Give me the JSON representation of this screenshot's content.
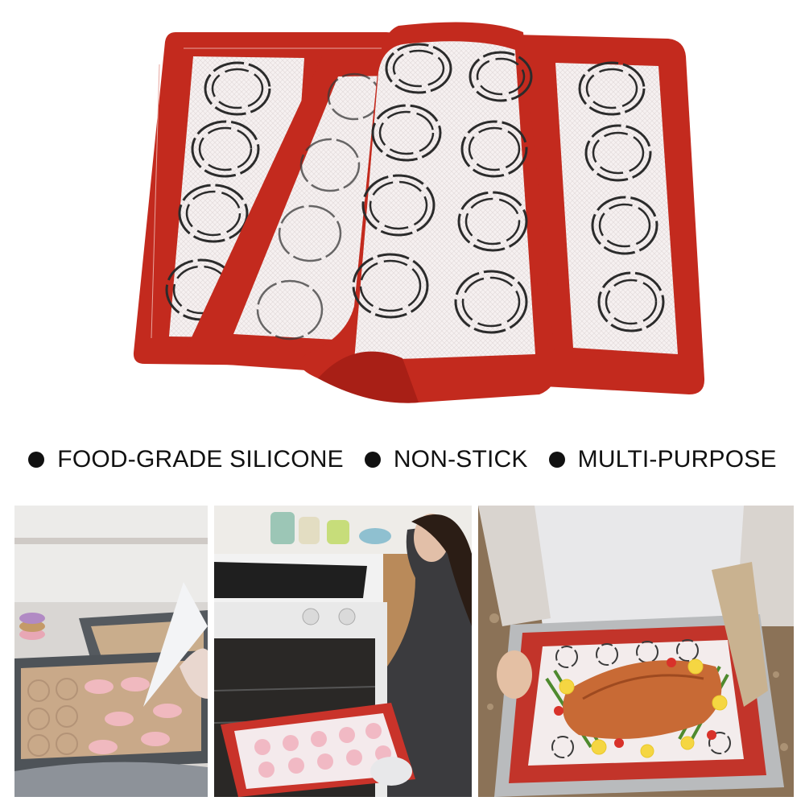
{
  "product": {
    "image_description": "Three red-bordered silicone baking mats with macaron circle guides, fanned out",
    "colors": {
      "border_red": "#c5261c",
      "mesh_white": "#f4efef",
      "circle_guide": "#2a2a2a"
    }
  },
  "features": [
    {
      "label": "FOOD-GRADE SILICONE"
    },
    {
      "label": "NON-STICK"
    },
    {
      "label": "MULTI-PURPOSE"
    }
  ],
  "photos": [
    {
      "subject": "piping macarons onto baking mat",
      "icon": "piping-bag-photo"
    },
    {
      "subject": "placing tray of macarons in oven",
      "icon": "oven-photo"
    },
    {
      "subject": "roasted salmon with vegetables on mat",
      "icon": "salmon-dish-photo"
    }
  ]
}
